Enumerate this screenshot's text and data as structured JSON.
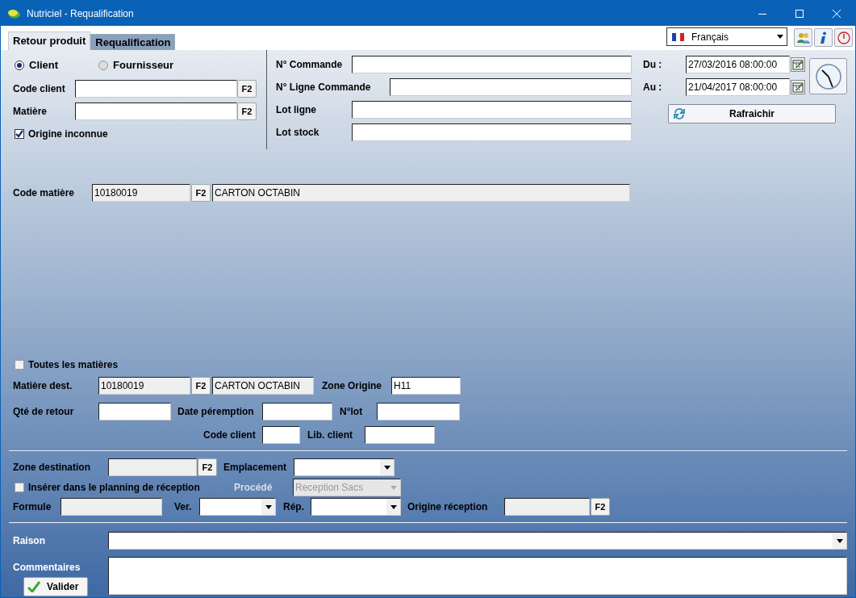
{
  "window": {
    "title": "Nutriciel - Requalification"
  },
  "tabs": [
    {
      "label": "Retour produit",
      "selected": true
    },
    {
      "label": "Requalification",
      "selected": false
    }
  ],
  "language": {
    "value": "Français"
  },
  "source_options": [
    {
      "label": "Client",
      "selected": true
    },
    {
      "label": "Fournisseur",
      "selected": false
    }
  ],
  "code_client": {
    "label": "Code client",
    "button": "F2"
  },
  "matiere": {
    "label": "Matière",
    "button": "F2"
  },
  "unknown_origin": {
    "label": "Origine inconnue",
    "checked": true
  },
  "order_fields": [
    {
      "label": "N° Commande"
    },
    {
      "label": "N° Ligne Commande"
    },
    {
      "label": "Lot ligne"
    },
    {
      "label": "Lot stock"
    }
  ],
  "period": [
    {
      "label": "Du :",
      "value": "27/03/2016 08:00:00"
    },
    {
      "label": "Au :",
      "value": "21/04/2017 08:00:00"
    }
  ],
  "refresh_button": "Rafraichir",
  "code_matiere": {
    "label": "Code matière",
    "code": "10180019",
    "button": "F2",
    "name": "CARTON OCTABIN",
    "disabled": true
  },
  "all_materials": {
    "label": "Toutes les matières",
    "checked": false
  },
  "dest_material": {
    "label": "Matière dest.",
    "code": "10180019",
    "button": "F2",
    "name": "CARTON OCTABIN",
    "disabled": true
  },
  "zone_origin": {
    "label": "Zone Origine",
    "value": "H11"
  },
  "return_qty": {
    "label": "Qté de retour"
  },
  "expiry_date": {
    "label": "Date péremption"
  },
  "lot_number": {
    "label": "N°lot"
  },
  "client_code": {
    "label": "Code client"
  },
  "client_name": {
    "label": "Lib. client"
  },
  "zone_destination": {
    "label": "Zone destination",
    "button": "F2",
    "disabled": true
  },
  "location": {
    "label": "Emplacement"
  },
  "insert_planning": {
    "label": "Insérer dans le planning de réception",
    "checked": false
  },
  "process": {
    "label": "Procédé",
    "value": "Reception Sacs",
    "disabled": true
  },
  "formula": {
    "label": "Formule",
    "disabled": true
  },
  "version": {
    "label": "Ver."
  },
  "rep": {
    "label": "Rép."
  },
  "reception_origin": {
    "label": "Origine réception",
    "button": "F2",
    "disabled": true
  },
  "reason": {
    "label": "Raison"
  },
  "comments": {
    "label": "Commentaires"
  },
  "validate_button": "Valider"
}
